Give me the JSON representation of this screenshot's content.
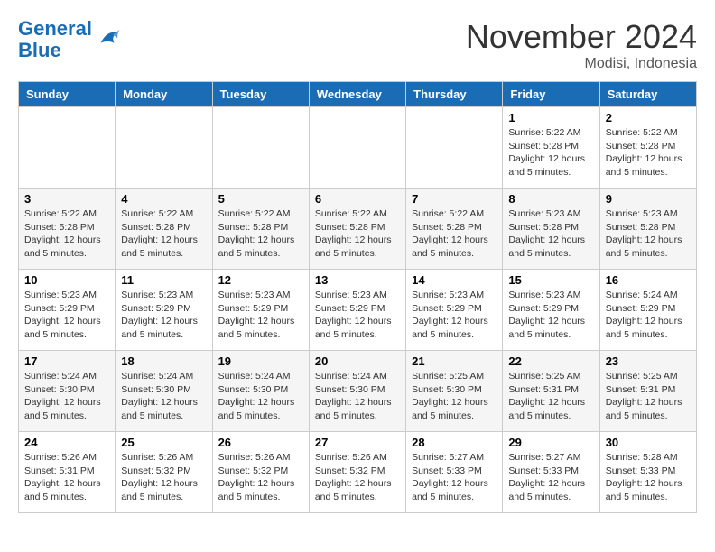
{
  "logo": {
    "text_general": "General",
    "text_blue": "Blue"
  },
  "title": "November 2024",
  "location": "Modisi, Indonesia",
  "weekdays": [
    "Sunday",
    "Monday",
    "Tuesday",
    "Wednesday",
    "Thursday",
    "Friday",
    "Saturday"
  ],
  "weeks": [
    [
      {
        "day": "",
        "info": ""
      },
      {
        "day": "",
        "info": ""
      },
      {
        "day": "",
        "info": ""
      },
      {
        "day": "",
        "info": ""
      },
      {
        "day": "",
        "info": ""
      },
      {
        "day": "1",
        "info": "Sunrise: 5:22 AM\nSunset: 5:28 PM\nDaylight: 12 hours and 5 minutes."
      },
      {
        "day": "2",
        "info": "Sunrise: 5:22 AM\nSunset: 5:28 PM\nDaylight: 12 hours and 5 minutes."
      }
    ],
    [
      {
        "day": "3",
        "info": "Sunrise: 5:22 AM\nSunset: 5:28 PM\nDaylight: 12 hours and 5 minutes."
      },
      {
        "day": "4",
        "info": "Sunrise: 5:22 AM\nSunset: 5:28 PM\nDaylight: 12 hours and 5 minutes."
      },
      {
        "day": "5",
        "info": "Sunrise: 5:22 AM\nSunset: 5:28 PM\nDaylight: 12 hours and 5 minutes."
      },
      {
        "day": "6",
        "info": "Sunrise: 5:22 AM\nSunset: 5:28 PM\nDaylight: 12 hours and 5 minutes."
      },
      {
        "day": "7",
        "info": "Sunrise: 5:22 AM\nSunset: 5:28 PM\nDaylight: 12 hours and 5 minutes."
      },
      {
        "day": "8",
        "info": "Sunrise: 5:23 AM\nSunset: 5:28 PM\nDaylight: 12 hours and 5 minutes."
      },
      {
        "day": "9",
        "info": "Sunrise: 5:23 AM\nSunset: 5:28 PM\nDaylight: 12 hours and 5 minutes."
      }
    ],
    [
      {
        "day": "10",
        "info": "Sunrise: 5:23 AM\nSunset: 5:29 PM\nDaylight: 12 hours and 5 minutes."
      },
      {
        "day": "11",
        "info": "Sunrise: 5:23 AM\nSunset: 5:29 PM\nDaylight: 12 hours and 5 minutes."
      },
      {
        "day": "12",
        "info": "Sunrise: 5:23 AM\nSunset: 5:29 PM\nDaylight: 12 hours and 5 minutes."
      },
      {
        "day": "13",
        "info": "Sunrise: 5:23 AM\nSunset: 5:29 PM\nDaylight: 12 hours and 5 minutes."
      },
      {
        "day": "14",
        "info": "Sunrise: 5:23 AM\nSunset: 5:29 PM\nDaylight: 12 hours and 5 minutes."
      },
      {
        "day": "15",
        "info": "Sunrise: 5:23 AM\nSunset: 5:29 PM\nDaylight: 12 hours and 5 minutes."
      },
      {
        "day": "16",
        "info": "Sunrise: 5:24 AM\nSunset: 5:29 PM\nDaylight: 12 hours and 5 minutes."
      }
    ],
    [
      {
        "day": "17",
        "info": "Sunrise: 5:24 AM\nSunset: 5:30 PM\nDaylight: 12 hours and 5 minutes."
      },
      {
        "day": "18",
        "info": "Sunrise: 5:24 AM\nSunset: 5:30 PM\nDaylight: 12 hours and 5 minutes."
      },
      {
        "day": "19",
        "info": "Sunrise: 5:24 AM\nSunset: 5:30 PM\nDaylight: 12 hours and 5 minutes."
      },
      {
        "day": "20",
        "info": "Sunrise: 5:24 AM\nSunset: 5:30 PM\nDaylight: 12 hours and 5 minutes."
      },
      {
        "day": "21",
        "info": "Sunrise: 5:25 AM\nSunset: 5:30 PM\nDaylight: 12 hours and 5 minutes."
      },
      {
        "day": "22",
        "info": "Sunrise: 5:25 AM\nSunset: 5:31 PM\nDaylight: 12 hours and 5 minutes."
      },
      {
        "day": "23",
        "info": "Sunrise: 5:25 AM\nSunset: 5:31 PM\nDaylight: 12 hours and 5 minutes."
      }
    ],
    [
      {
        "day": "24",
        "info": "Sunrise: 5:26 AM\nSunset: 5:31 PM\nDaylight: 12 hours and 5 minutes."
      },
      {
        "day": "25",
        "info": "Sunrise: 5:26 AM\nSunset: 5:32 PM\nDaylight: 12 hours and 5 minutes."
      },
      {
        "day": "26",
        "info": "Sunrise: 5:26 AM\nSunset: 5:32 PM\nDaylight: 12 hours and 5 minutes."
      },
      {
        "day": "27",
        "info": "Sunrise: 5:26 AM\nSunset: 5:32 PM\nDaylight: 12 hours and 5 minutes."
      },
      {
        "day": "28",
        "info": "Sunrise: 5:27 AM\nSunset: 5:33 PM\nDaylight: 12 hours and 5 minutes."
      },
      {
        "day": "29",
        "info": "Sunrise: 5:27 AM\nSunset: 5:33 PM\nDaylight: 12 hours and 5 minutes."
      },
      {
        "day": "30",
        "info": "Sunrise: 5:28 AM\nSunset: 5:33 PM\nDaylight: 12 hours and 5 minutes."
      }
    ]
  ]
}
